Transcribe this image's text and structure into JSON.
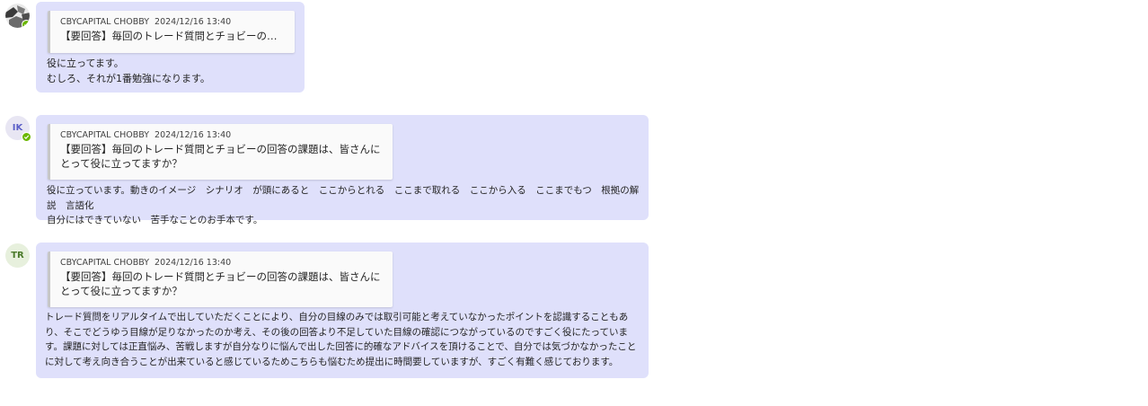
{
  "messages": [
    {
      "avatar": {
        "type": "photo",
        "initials": "",
        "presence": "available"
      },
      "quote": {
        "author": "CBYCAPITAL CHOBBY",
        "timestamp": "2024/12/16 13:40",
        "text": "【要回答】毎回のトレード質問とチョビーの回答の課題..."
      },
      "body": "役に立ってます。\nむしろ、それが1番勉強になります。"
    },
    {
      "avatar": {
        "type": "initials",
        "initials": "IK",
        "presence": "available"
      },
      "quote": {
        "author": "CBYCAPITAL CHOBBY",
        "timestamp": "2024/12/16 13:40",
        "text": "【要回答】毎回のトレード質問とチョビーの回答の課題は、皆さんにとって役に立ってますか？"
      },
      "body": "役に立っています。動きのイメージ　シナリオ　が頭にあると　ここからとれる　ここまで取れる　ここから入る　ここまでもつ　根拠の解説　言語化\n自分にはできていない　苦手なことのお手本です。"
    },
    {
      "avatar": {
        "type": "initials",
        "initials": "TR",
        "presence": "none"
      },
      "quote": {
        "author": "CBYCAPITAL CHOBBY",
        "timestamp": "2024/12/16 13:40",
        "text": "【要回答】毎回のトレード質問とチョビーの回答の課題は、皆さんにとって役に立ってますか？"
      },
      "body": "トレード質問をリアルタイムで出していただくことにより、自分の目線のみでは取引可能と考えていなかったポイントを認識することもあり、そこでどうゆう目線が足りなかったのか考え、その後の回答より不足していた目線の確認につながっているのですごく役にたっています。課題に対しては正直悩み、苦戦しますが自分なりに悩んで出した回答に的確なアドバイスを頂けることで、自分では気づかなかったことに対して考え向き合うことが出来ていると感じているためこちらも悩むため提出に時間要していますが、すごく有難く感じております。"
    }
  ],
  "colors": {
    "bubble_bg": "#dfe0fb",
    "quote_bg": "#fafafa",
    "presence_available": "#6bb700",
    "avatar_ik_bg": "#e8e6f3",
    "avatar_ik_fg": "#5b5fc7",
    "avatar_tr_bg": "#e7f0dd",
    "avatar_tr_fg": "#4a7a2a"
  }
}
